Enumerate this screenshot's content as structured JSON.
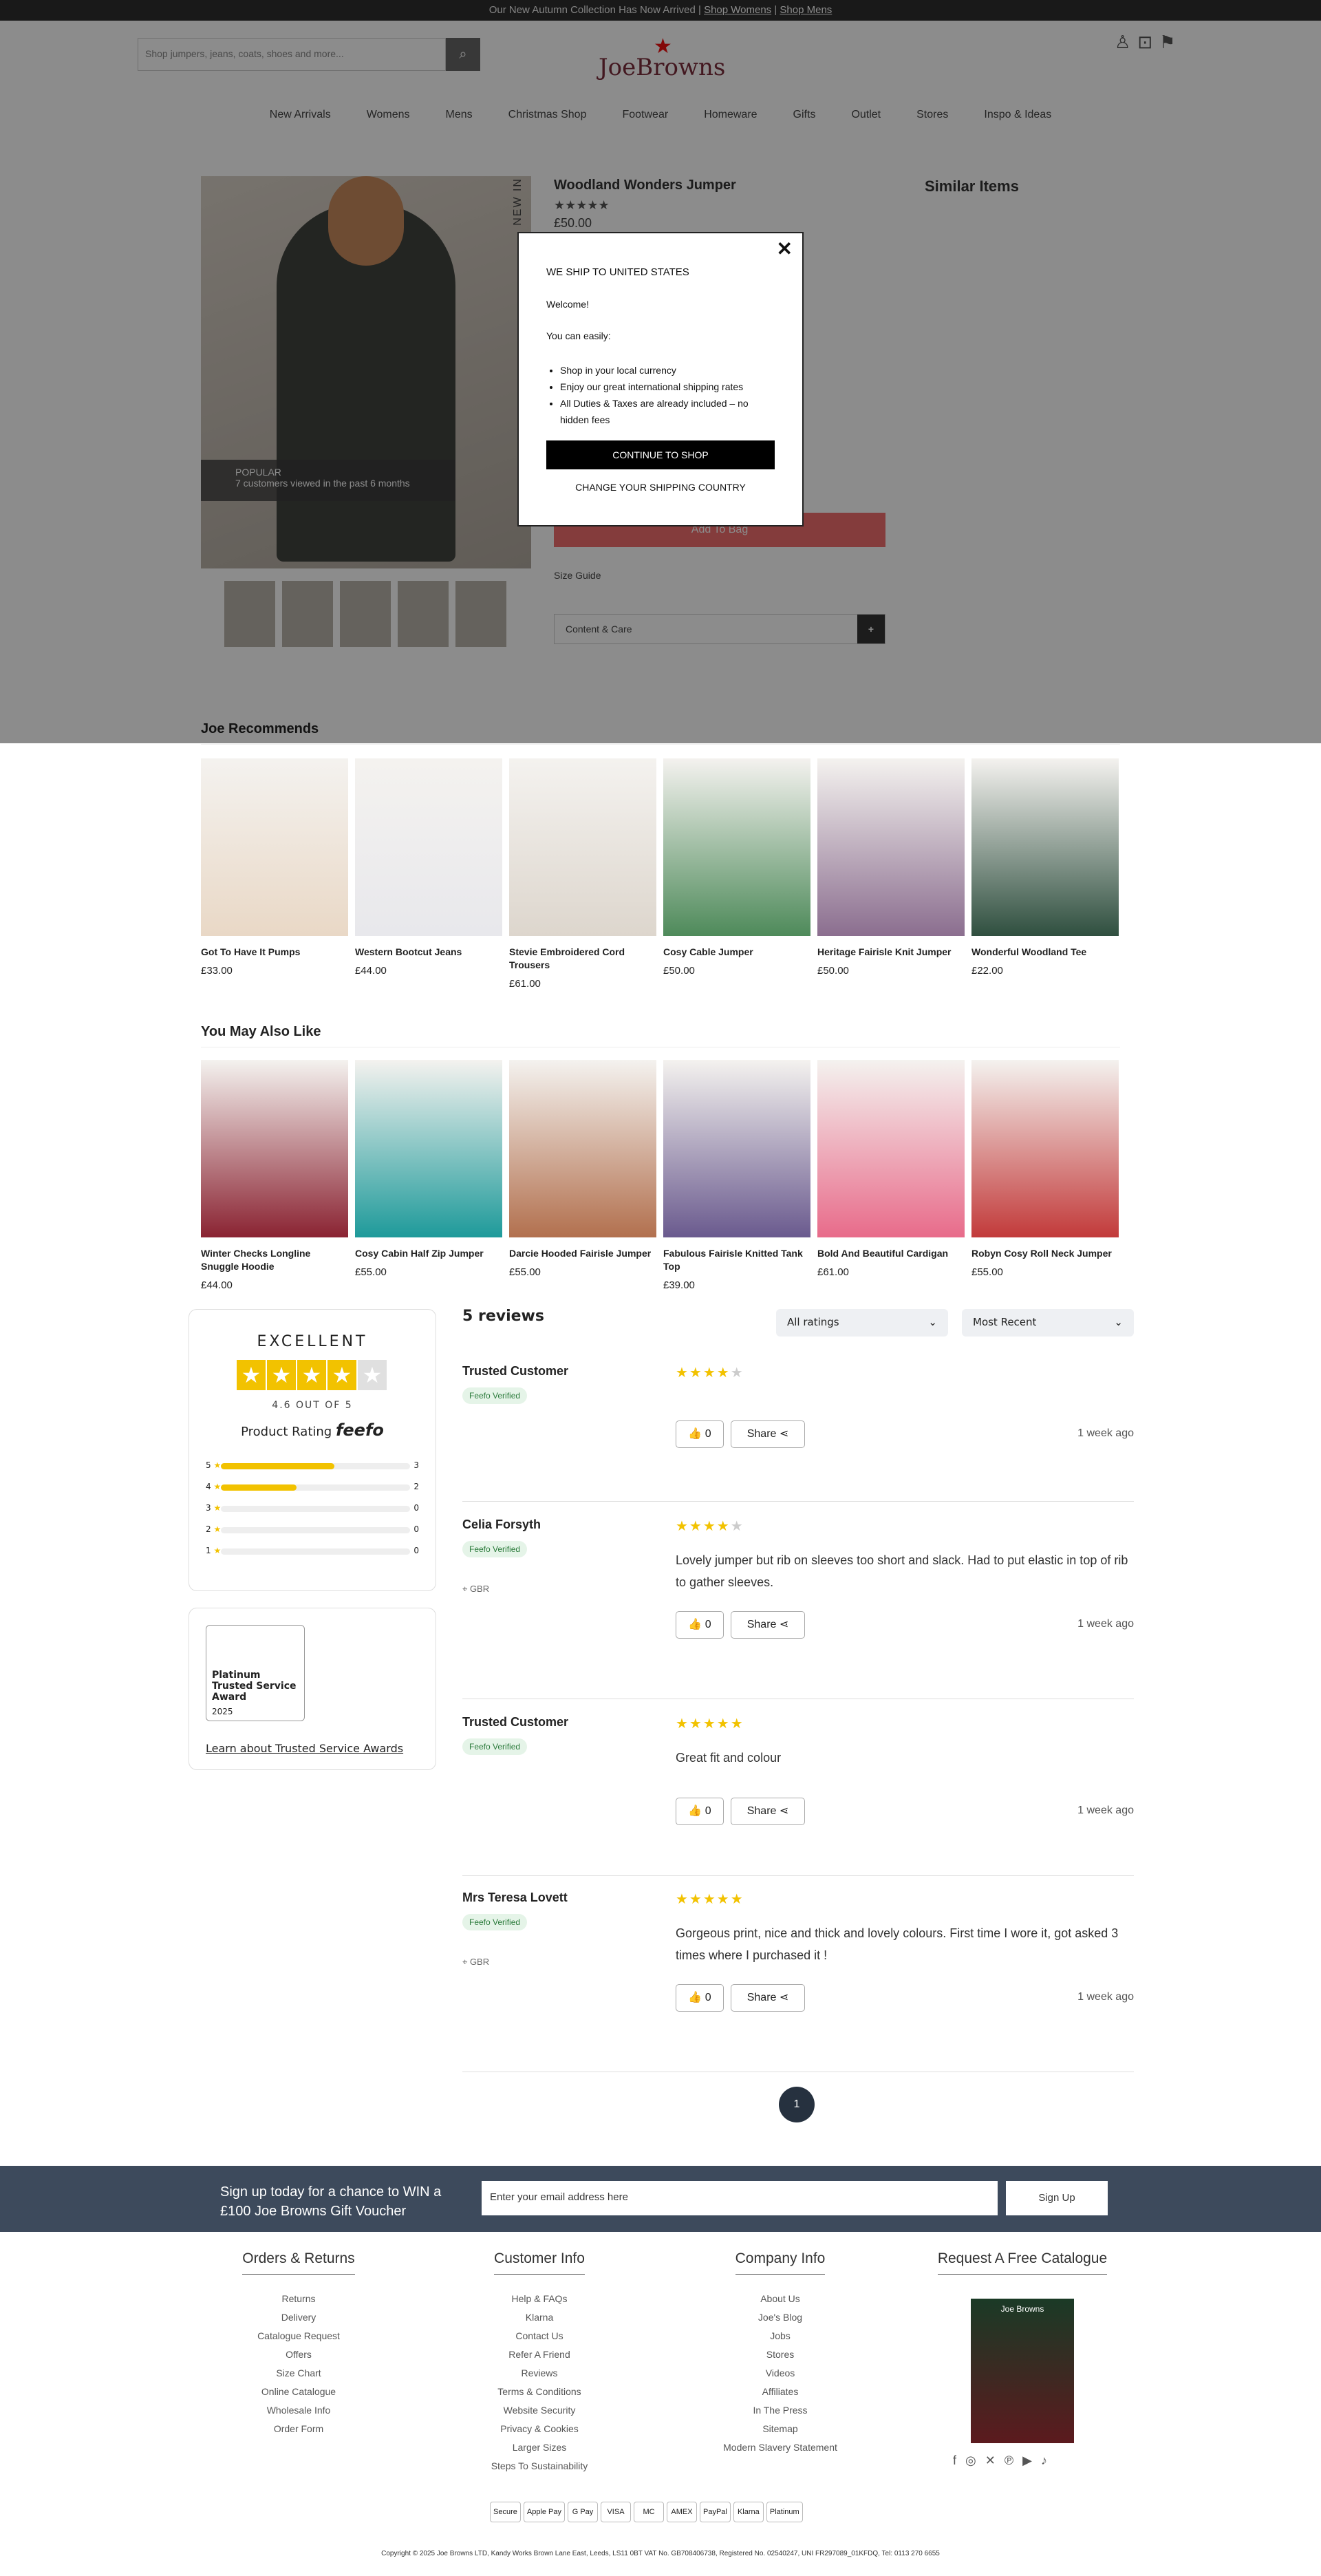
{
  "topbar": {
    "text": "Our New Autumn Collection Has Now Arrived | ",
    "link1": "Shop Womens",
    "sep": " | ",
    "link2": "Shop Mens"
  },
  "header": {
    "search_placeholder": "Shop jumpers, jeans, coats, shoes and more...",
    "logo": "JoeBrowns"
  },
  "nav": [
    "New Arrivals",
    "Womens",
    "Mens",
    "Christmas Shop",
    "Footwear",
    "Homeware",
    "Gifts",
    "Outlet",
    "Stores",
    "Inspo & Ideas"
  ],
  "product": {
    "newin": "NEW IN",
    "title": "Woodland Wonders Jumper",
    "stars": "★★★★★",
    "price": "£50.00",
    "overlay_title": "POPULAR",
    "overlay_text": "7 customers viewed in the past 6 months",
    "add_to_bag": "Add To Bag",
    "size_guide": "Size Guide",
    "accordion": "Content & Care",
    "similar": "Similar Items"
  },
  "modal": {
    "title": "WE SHIP TO UNITED STATES",
    "welcome": "Welcome!",
    "can": "You can easily:",
    "bullets": [
      "Shop in your local currency",
      "Enjoy our great international shipping rates",
      "All Duties & Taxes are already included – no hidden fees"
    ],
    "continue": "CONTINUE TO SHOP",
    "change": "CHANGE YOUR SHIPPING COUNTRY"
  },
  "recommends": {
    "title": "Joe Recommends",
    "items": [
      {
        "name": "Got To Have It Pumps",
        "price": "£33.00",
        "color": "#e9d8c6"
      },
      {
        "name": "Western Bootcut Jeans",
        "price": "£44.00",
        "color": "#e8e8ec"
      },
      {
        "name": "Stevie Embroidered Cord Trousers",
        "price": "£61.00",
        "color": "#ddd6cd"
      },
      {
        "name": "Cosy Cable Jumper",
        "price": "£50.00",
        "color": "#4e8a5a"
      },
      {
        "name": "Heritage Fairisle Knit Jumper",
        "price": "£50.00",
        "color": "#8b6e8f"
      },
      {
        "name": "Wonderful Woodland Tee",
        "price": "£22.00",
        "color": "#2f4f3f"
      }
    ]
  },
  "alsolike": {
    "title": "You May Also Like",
    "items": [
      {
        "name": "Winter Checks Longline Snuggle Hoodie",
        "price": "£44.00",
        "color": "#8a2332"
      },
      {
        "name": "Cosy Cabin Half Zip Jumper",
        "price": "£55.00",
        "color": "#1e9a9a"
      },
      {
        "name": "Darcie Hooded Fairisle Jumper",
        "price": "£55.00",
        "color": "#b2704e"
      },
      {
        "name": "Fabulous Fairisle Knitted Tank Top",
        "price": "£39.00",
        "color": "#6a5a8e"
      },
      {
        "name": "Bold And Beautiful Cardigan",
        "price": "£61.00",
        "color": "#e86b8a"
      },
      {
        "name": "Robyn Cosy Roll Neck Jumper",
        "price": "£55.00",
        "color": "#c23a3a"
      }
    ]
  },
  "feefo": {
    "excellent": "EXCELLENT",
    "out_of": "4.6 OUT OF 5",
    "product_rating": "Product Rating",
    "brand": "feefo",
    "bars": [
      {
        "star": "5",
        "count": "3",
        "pct": 0.6
      },
      {
        "star": "4",
        "count": "2",
        "pct": 0.4
      },
      {
        "star": "3",
        "count": "0",
        "pct": 0
      },
      {
        "star": "2",
        "count": "0",
        "pct": 0
      },
      {
        "star": "1",
        "count": "0",
        "pct": 0
      }
    ],
    "award_title": "Platinum Trusted Service Award",
    "award_year": "2025",
    "learn": "Learn about Trusted Service Awards"
  },
  "reviews": {
    "count": "5 reviews",
    "filter": "All ratings",
    "sort": "Most Recent",
    "verified": "Feefo Verified",
    "items": [
      {
        "name": "Trusted Customer",
        "stars": "★★★★",
        "empty": "★",
        "text": "",
        "loc": "",
        "likes": "0",
        "share": "Share",
        "ago": "1 week ago"
      },
      {
        "name": "Celia Forsyth",
        "stars": "★★★★",
        "empty": "★",
        "text": "Lovely jumper but rib on sleeves too short and slack. Had to put elastic in top of rib to gather sleeves.",
        "loc": "GBR",
        "likes": "0",
        "share": "Share",
        "ago": "1 week ago"
      },
      {
        "name": "Trusted Customer",
        "stars": "★★★★★",
        "empty": "",
        "text": "Great fit and colour",
        "loc": "",
        "likes": "0",
        "share": "Share",
        "ago": "1 week ago"
      },
      {
        "name": "Mrs Teresa Lovett",
        "stars": "★★★★★",
        "empty": "",
        "text": "Gorgeous print, nice and thick and lovely colours. First time I wore it, got asked 3 times where I purchased it !",
        "loc": "GBR",
        "likes": "0",
        "share": "Share",
        "ago": "1 week ago"
      }
    ],
    "page": "1"
  },
  "signup": {
    "text": "Sign up today for a chance to WIN a £100 Joe Browns Gift Voucher",
    "placeholder": "Enter your email address here",
    "button": "Sign Up"
  },
  "footer": {
    "orders": {
      "title": "Orders & Returns",
      "links": [
        "Returns",
        "Delivery",
        "Catalogue Request",
        "Offers",
        "Size Chart",
        "Online Catalogue",
        "Wholesale Info",
        "Order Form"
      ]
    },
    "customer": {
      "title": "Customer Info",
      "links": [
        "Help & FAQs",
        "Klarna",
        "Contact Us",
        "Refer A Friend",
        "Reviews",
        "Terms & Conditions",
        "Website Security",
        "Privacy & Cookies",
        "Larger Sizes",
        "Steps To Sustainability"
      ]
    },
    "company": {
      "title": "Company Info",
      "links": [
        "About Us",
        "Joe's Blog",
        "Jobs",
        "Stores",
        "Videos",
        "Affiliates",
        "In The Press",
        "Sitemap",
        "Modern Slavery Statement"
      ]
    },
    "catalogue": {
      "title": "Request A Free Catalogue",
      "cover": "Joe Browns"
    },
    "payments": [
      "Secure",
      "Apple Pay",
      "G Pay",
      "VISA",
      "MC",
      "AMEX",
      "PayPal",
      "Klarna",
      "Platinum"
    ],
    "copyright": "Copyright © 2025 Joe Browns LTD, Kandy Works Brown Lane East, Leeds, LS11 0BT VAT No. GB708406738, Registered No. 02540247, UNI FR297089_01KFDQ, Tel: 0113 270 6655"
  }
}
